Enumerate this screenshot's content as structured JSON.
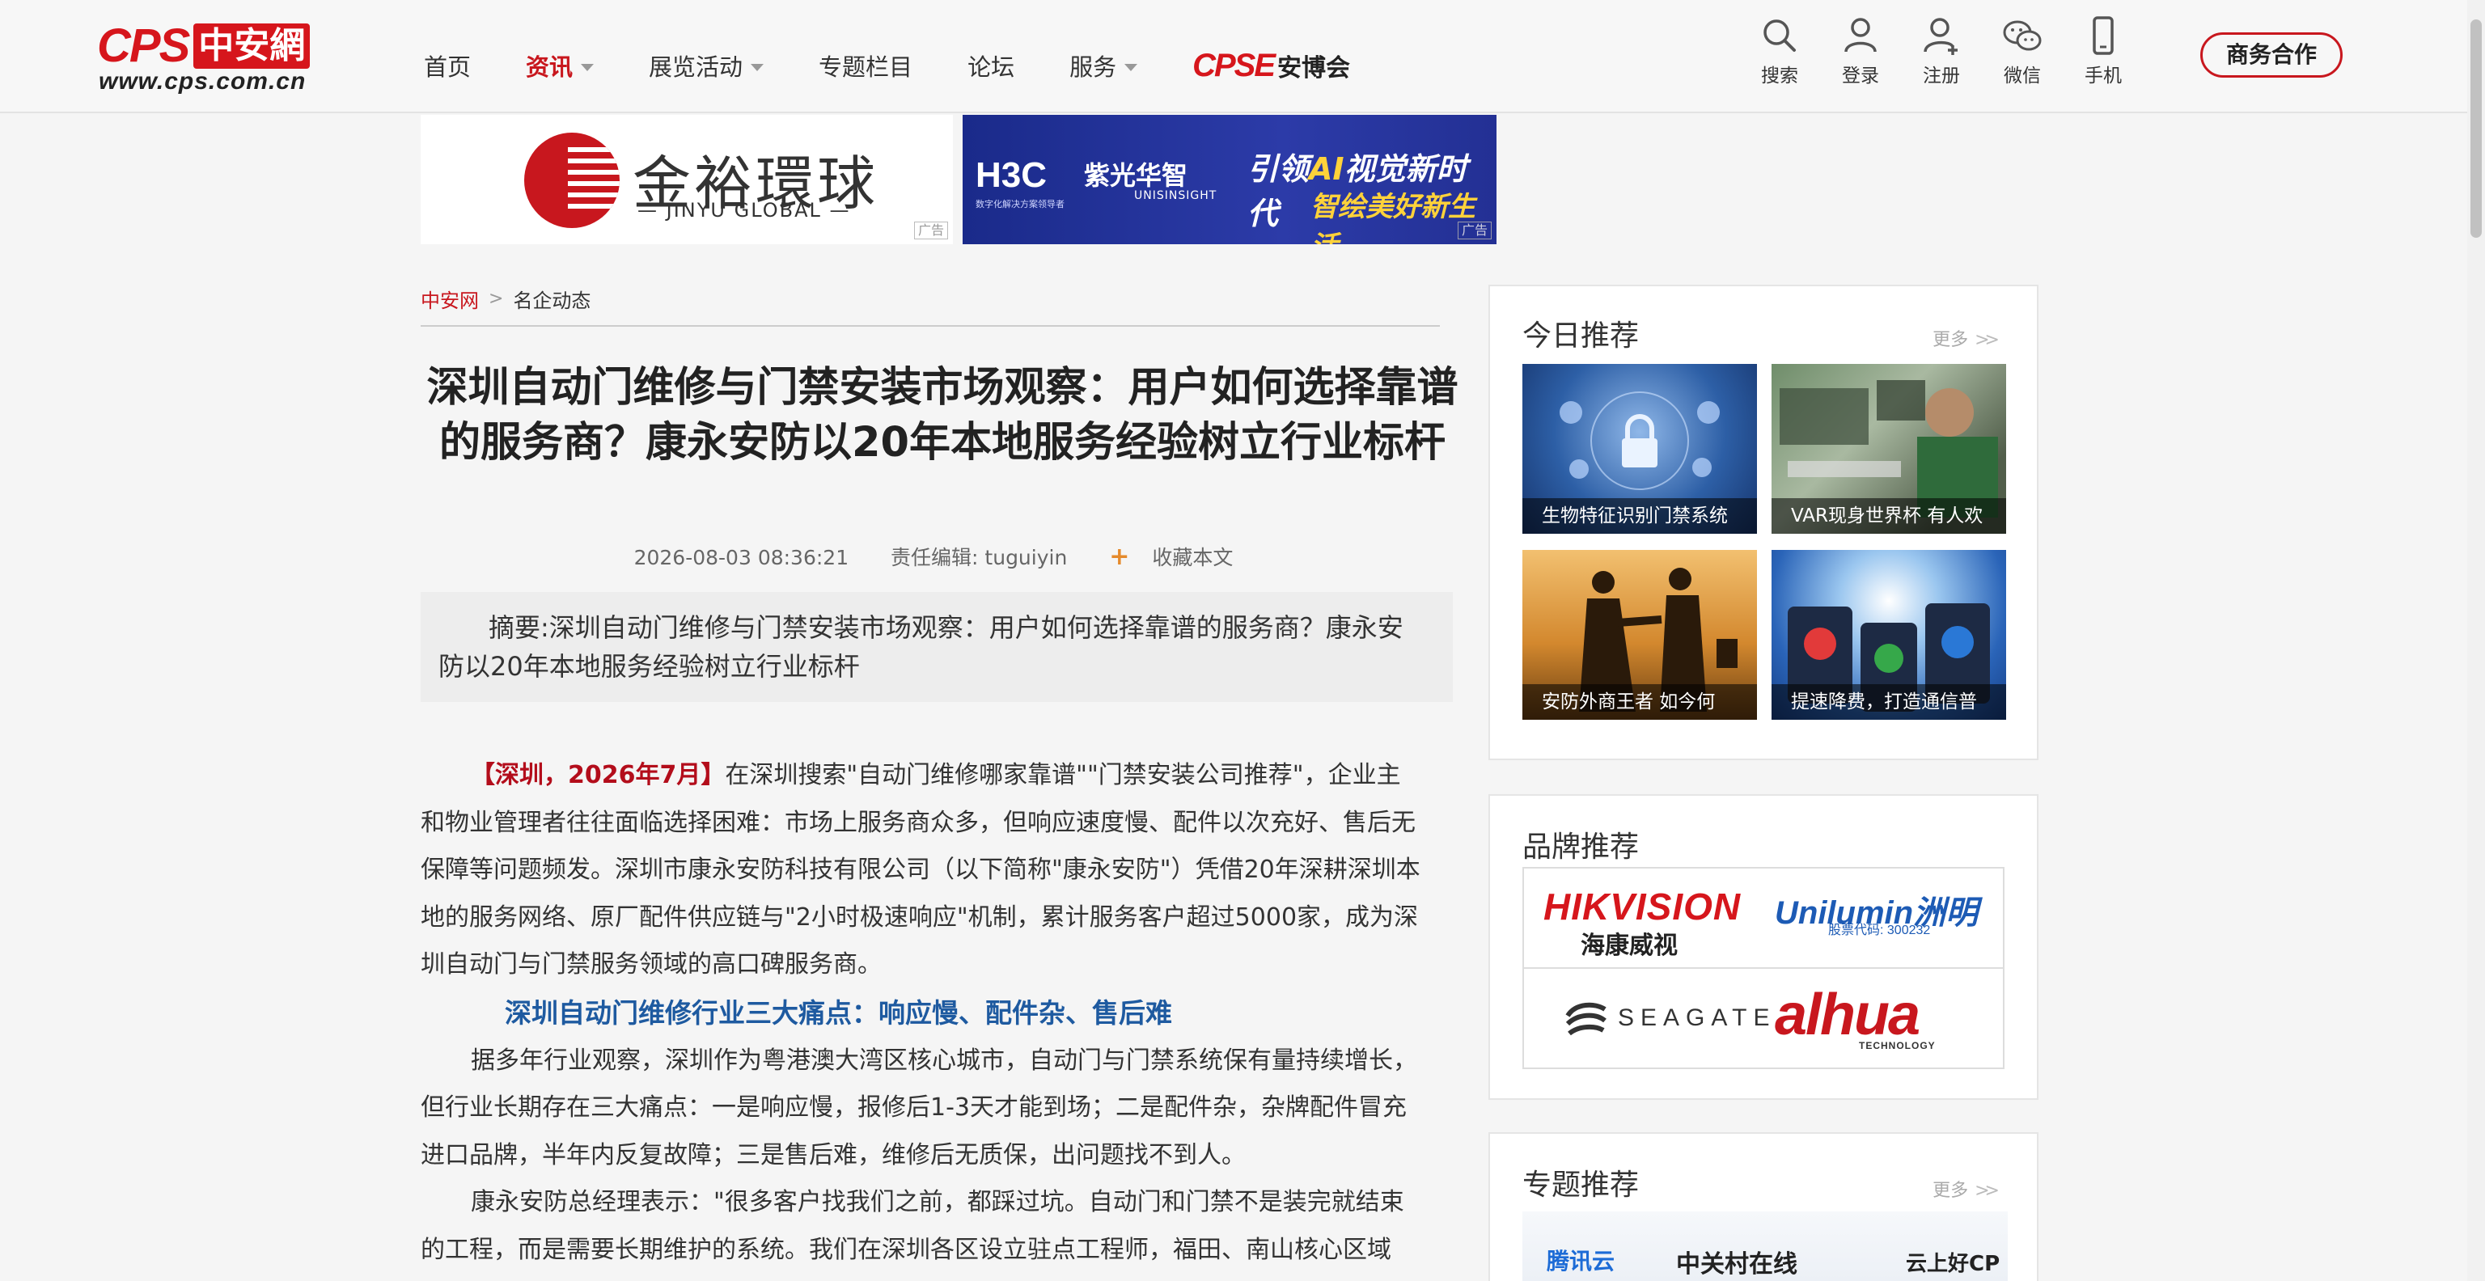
{
  "header": {
    "logo": {
      "main": "CPS",
      "cn": "中安網",
      "url": "www.cps.com.cn"
    },
    "nav": [
      {
        "label": "首页",
        "active": false,
        "dropdown": false
      },
      {
        "label": "资讯",
        "active": true,
        "dropdown": true
      },
      {
        "label": "展览活动",
        "active": false,
        "dropdown": true
      },
      {
        "label": "专题栏目",
        "active": false,
        "dropdown": false
      },
      {
        "label": "论坛",
        "active": false,
        "dropdown": false
      },
      {
        "label": "服务",
        "active": false,
        "dropdown": true
      }
    ],
    "cpse": {
      "mark": "CPSE",
      "label": "安博会"
    },
    "tools": [
      {
        "label": "搜索",
        "icon": "search-icon"
      },
      {
        "label": "登录",
        "icon": "user-icon"
      },
      {
        "label": "注册",
        "icon": "add-user-icon"
      },
      {
        "label": "微信",
        "icon": "wechat-icon"
      },
      {
        "label": "手机",
        "icon": "mobile-icon"
      }
    ],
    "business_button": "商务合作"
  },
  "ads": {
    "jinyu": {
      "cn": "金裕環球",
      "en": "— JINYU GLOBAL —",
      "label": "广告"
    },
    "h3c": {
      "brand": "H3C",
      "sub": "数字化解决方案领导者",
      "ziguang": "紫光华智",
      "ziguang_en": "UNISINSIGHT",
      "line1_a": "引领",
      "line1_ai": "AI",
      "line1_b": "视觉新时代",
      "line2": "智绘美好新生活",
      "label": "广告"
    }
  },
  "breadcrumb": {
    "home": "中安网",
    "separator": ">",
    "current": "名企动态"
  },
  "article": {
    "title": "深圳自动门维修与门禁安装市场观察：用户如何选择靠谱的服务商？康永安防以20年本地服务经验树立行业标杆",
    "date": "2026-08-03 08:36:21",
    "editor": "责任编辑: tuguiyin",
    "favorite": "收藏本文",
    "summary": "摘要:深圳自动门维修与门禁安装市场观察：用户如何选择靠谱的服务商？康永安防以20年本地服务经验树立行业标杆",
    "lead": "【深圳，2026年7月】",
    "p1": "在深圳搜索\"自动门维修哪家靠谱\"\"门禁安装公司推荐\"，企业主和物业管理者往往面临选择困难：市场上服务商众多，但响应速度慢、配件以次充好、售后无保障等问题频发。深圳市康永安防科技有限公司（以下简称\"康永安防\"）凭借20年深耕深圳本地的服务网络、原厂配件供应链与\"2小时极速响应\"机制，累计服务客户超过5000家，成为深圳自动门与门禁服务领域的高口碑服务商。",
    "subheading": "深圳自动门维修行业三大痛点：响应慢、配件杂、售后难",
    "p2": "据多年行业观察，深圳作为粤港澳大湾区核心城市，自动门与门禁系统保有量持续增长，但行业长期存在三大痛点：一是响应慢，报修后1-3天才能到场；二是配件杂，杂牌配件冒充进口品牌，半年内反复故障；三是售后难，维修后无质保，出问题找不到人。",
    "p3": "康永安防总经理表示：\"很多客户找我们之前，都踩过坑。自动门和门禁不是装完就结束的工程，而是需要长期维护的系统。我们在深圳各区设立驻点工程师，福田、南山核心区域"
  },
  "sidebar": {
    "today": {
      "title": "今日推荐",
      "more": "更多",
      "items": [
        {
          "caption": "生物特征识别门禁系统"
        },
        {
          "caption": "VAR现身世界杯 有人欢"
        },
        {
          "caption": "安防外商王者 如今何"
        },
        {
          "caption": "提速降费，打造通信普"
        }
      ]
    },
    "brands": {
      "title": "品牌推荐",
      "items": [
        {
          "name": "HIKVISION",
          "cn": "海康威视"
        },
        {
          "name": "Unilumin洲明",
          "sub": "股票代码: 300232"
        },
        {
          "name": "SEAGATE"
        },
        {
          "name": "alhua",
          "sub": "TECHNOLOGY"
        }
      ]
    },
    "topics": {
      "title": "专题推荐",
      "more": "更多",
      "banner": {
        "a": "腾讯云",
        "b": "中关村在线",
        "c": "云上好CP"
      }
    }
  }
}
